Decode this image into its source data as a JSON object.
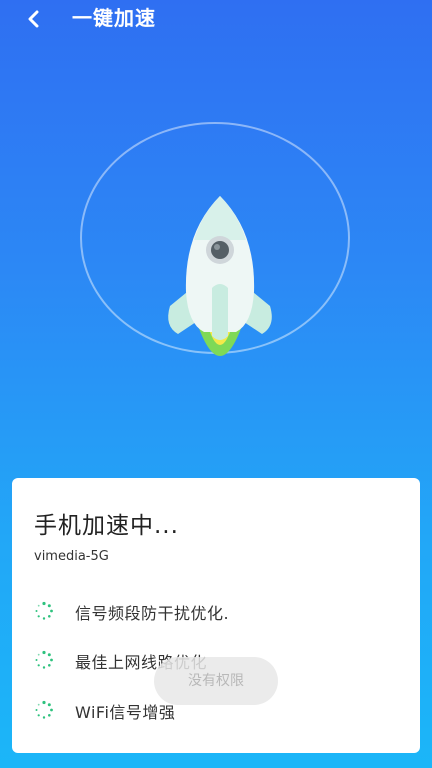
{
  "header": {
    "title": "一键加速"
  },
  "card": {
    "title": "手机加速中...",
    "ssid": "vimedia-5G",
    "items": [
      {
        "label": "信号频段防干扰优化."
      },
      {
        "label": "最佳上网线路优化"
      },
      {
        "label": "WiFi信号增强"
      }
    ]
  },
  "toast": {
    "text": "没有权限"
  },
  "colors": {
    "background_top": "#2f6ff2",
    "background_bottom": "#1bb6f8",
    "rocket_body": "#eef7f5",
    "rocket_fin": "#c8ece0",
    "flame_outer": "#7ed957",
    "flame_inner": "#f5e94a",
    "spinner": "#2ec27e"
  },
  "icons": {
    "back": "chevron-left-icon",
    "rocket": "rocket-icon",
    "spinner": "loading-spinner-icon"
  }
}
